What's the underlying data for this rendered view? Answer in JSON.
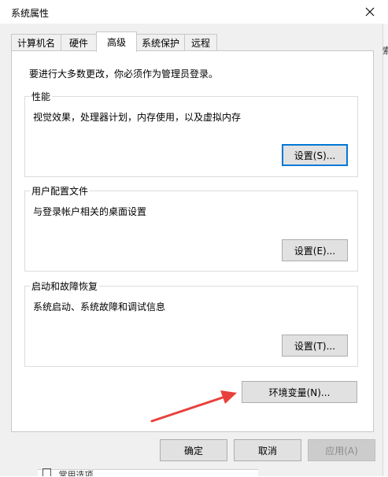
{
  "window": {
    "title": "系统属性"
  },
  "tabs": [
    {
      "label": "计算机名"
    },
    {
      "label": "硬件"
    },
    {
      "label": "高级",
      "active": true
    },
    {
      "label": "系统保护"
    },
    {
      "label": "远程"
    }
  ],
  "panel": {
    "intro": "要进行大多数更改，你必须作为管理员登录。",
    "groups": [
      {
        "title": "性能",
        "description": "视觉效果，处理器计划，内存使用，以及虚拟内存",
        "button": "设置(S)..."
      },
      {
        "title": "用户配置文件",
        "description": "与登录帐户相关的桌面设置",
        "button": "设置(E)..."
      },
      {
        "title": "启动和故障恢复",
        "description": "系统启动、系统故障和调试信息",
        "button": "设置(T)..."
      }
    ],
    "env_button": "环境变量(N)..."
  },
  "footer": {
    "ok": "确定",
    "cancel": "取消",
    "apply": "应用(A)"
  },
  "background": {
    "right_fragment": "索",
    "bottom_fragment": "常用选项"
  },
  "colors": {
    "annotation_arrow": "#e8413c",
    "focus_border": "#0078d7"
  }
}
